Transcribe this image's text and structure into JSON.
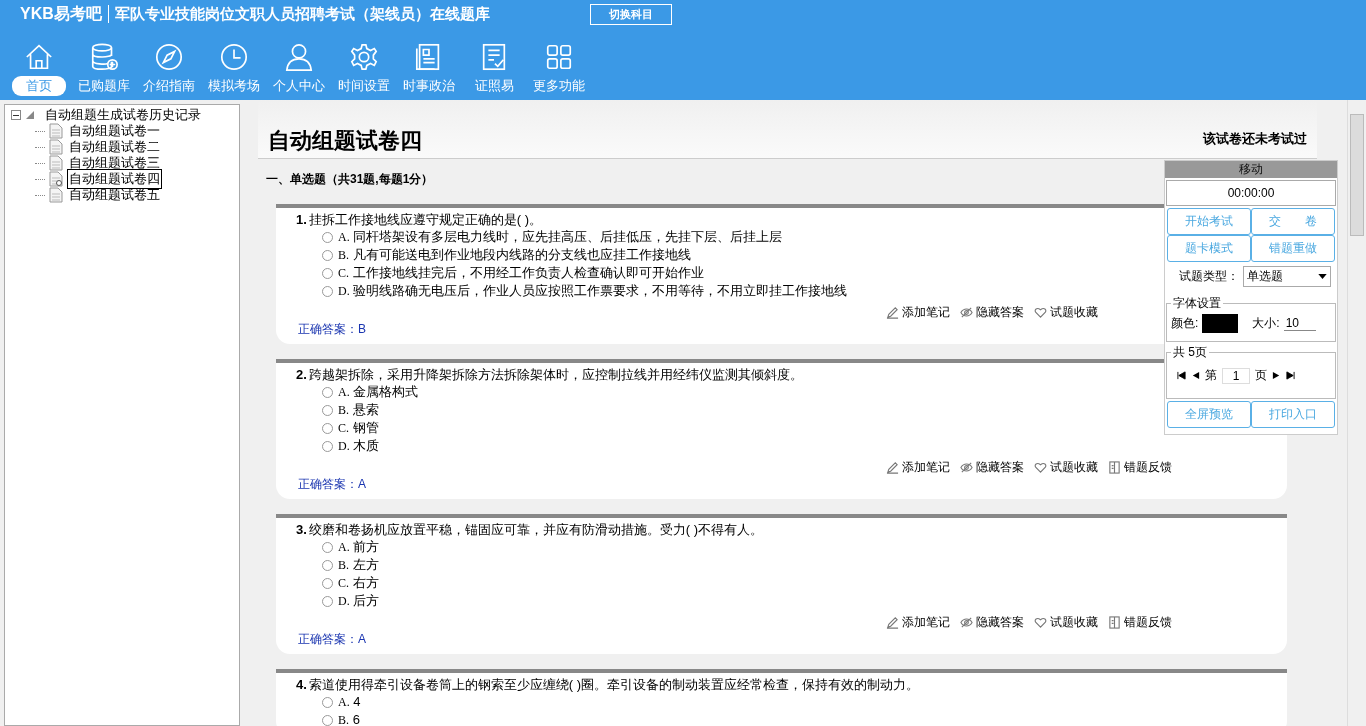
{
  "header": {
    "logo": "YKB易考吧",
    "title": "军队专业技能岗位文职人员招聘考试（架线员）在线题库",
    "switch_button": "切换科目"
  },
  "nav": [
    {
      "label": "首页",
      "selected": true
    },
    {
      "label": "已购题库",
      "selected": false
    },
    {
      "label": "介绍指南",
      "selected": false
    },
    {
      "label": "模拟考场",
      "selected": false
    },
    {
      "label": "个人中心",
      "selected": false
    },
    {
      "label": "时间设置",
      "selected": false
    },
    {
      "label": "时事政治",
      "selected": false
    },
    {
      "label": "证照易",
      "selected": false
    },
    {
      "label": "更多功能",
      "selected": false
    }
  ],
  "tree": {
    "label": "自动组题生成试卷历史记录",
    "expanded": true,
    "children": [
      {
        "label": "自动组题试卷一",
        "selected": false
      },
      {
        "label": "自动组题试卷二",
        "selected": false
      },
      {
        "label": "自动组题试卷三",
        "selected": false
      },
      {
        "label": "自动组题试卷四",
        "selected": true
      },
      {
        "label": "自动组题试卷五",
        "selected": false
      }
    ]
  },
  "paper": {
    "title": "自动组题试卷四",
    "status": "该试卷还未考试过",
    "section": "一、单选题（共31题,每题1分）",
    "questions": [
      {
        "number": "1.",
        "text": "挂拆工作接地线应遵守规定正确的是( )。",
        "options": [
          {
            "letter": "A.",
            "text": "同杆塔架设有多层电力线时，应先挂高压、后挂低压，先挂下层、后挂上层",
            "selected": false
          },
          {
            "letter": "B.",
            "text": "凡有可能送电到作业地段内线路的分支线也应挂工作接地线",
            "selected": false
          },
          {
            "letter": "C.",
            "text": "工作接地线挂完后，不用经工作负责人检查确认即可开始作业",
            "selected": false
          },
          {
            "letter": "D.",
            "text": "验明线路确无电压后，作业人员应按照工作票要求，不用等待，不用立即挂工作接地线",
            "selected": false
          }
        ],
        "actions": [
          {
            "kind": "note",
            "label": "添加笔记"
          },
          {
            "kind": "hide",
            "label": "隐藏答案"
          },
          {
            "kind": "favorite",
            "label": "试题收藏"
          }
        ],
        "answer": "正确答案：B"
      },
      {
        "number": "2.",
        "text": "跨越架拆除，采用升降架拆除方法拆除架体时，应控制拉线并用经纬仪监测其倾斜度。",
        "options": [
          {
            "letter": "A.",
            "text": "金属格构式",
            "selected": false
          },
          {
            "letter": "B.",
            "text": "悬索",
            "selected": false
          },
          {
            "letter": "C.",
            "text": "钢管",
            "selected": false
          },
          {
            "letter": "D.",
            "text": "木质",
            "selected": false
          }
        ],
        "actions": [
          {
            "kind": "note",
            "label": "添加笔记"
          },
          {
            "kind": "hide",
            "label": "隐藏答案"
          },
          {
            "kind": "favorite",
            "label": "试题收藏"
          },
          {
            "kind": "feedback",
            "label": "错题反馈"
          }
        ],
        "answer": "正确答案：A"
      },
      {
        "number": "3.",
        "text": "绞磨和卷扬机应放置平稳，锚固应可靠，并应有防滑动措施。受力( )不得有人。",
        "options": [
          {
            "letter": "A.",
            "text": "前方",
            "selected": false
          },
          {
            "letter": "B.",
            "text": "左方",
            "selected": false
          },
          {
            "letter": "C.",
            "text": "右方",
            "selected": false
          },
          {
            "letter": "D.",
            "text": "后方",
            "selected": false
          }
        ],
        "actions": [
          {
            "kind": "note",
            "label": "添加笔记"
          },
          {
            "kind": "hide",
            "label": "隐藏答案"
          },
          {
            "kind": "favorite",
            "label": "试题收藏"
          },
          {
            "kind": "feedback",
            "label": "错题反馈"
          }
        ],
        "answer": "正确答案：A"
      },
      {
        "number": "4.",
        "text": "索道使用得牵引设备卷筒上的钢索至少应缠绕( )圈。牵引设备的制动装置应经常检查，保持有效的制动力。",
        "options": [
          {
            "letter": "A.",
            "text": "4",
            "selected": false
          },
          {
            "letter": "B.",
            "text": "6",
            "selected": false
          }
        ]
      }
    ]
  },
  "panel": {
    "title": "移动",
    "timer": "00:00:00",
    "buttons": [
      "开始考试",
      "交　　卷",
      "题卡模式",
      "错题重做"
    ],
    "type_label": "试题类型：",
    "type_value": "单选题",
    "font_legend": "字体设置",
    "color_label": "颜色:",
    "color": "#000000",
    "size_label": "大小:",
    "size_value": "10",
    "pages_legend": "共 5页",
    "page_prefix": "第",
    "page_value": "1",
    "page_suffix": "页",
    "bottom_buttons": [
      "全屏预览",
      "打印入口"
    ]
  }
}
